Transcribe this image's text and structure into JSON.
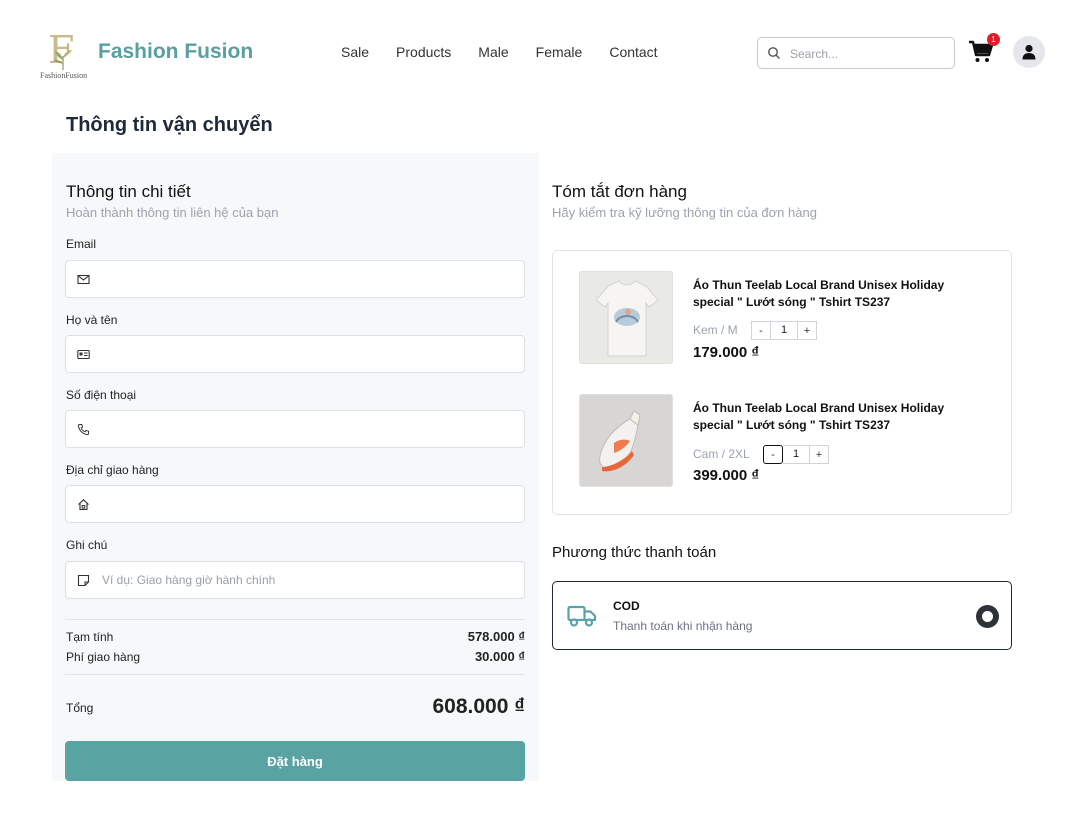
{
  "header": {
    "logo_letter": "F",
    "logo_small": "FashionFusion",
    "brand": "Fashion Fusion",
    "nav": [
      "Sale",
      "Products",
      "Male",
      "Female",
      "Contact"
    ],
    "search_placeholder": "Search...",
    "cart_count": "1"
  },
  "page_title": "Thông tin vận chuyển",
  "details": {
    "title": "Thông tin chi tiết",
    "subtitle": "Hoàn thành thông tin liên hệ của bạn",
    "fields": [
      {
        "label": "Email",
        "icon": "envelope-icon",
        "value": "",
        "placeholder": ""
      },
      {
        "label": "Họ và tên",
        "icon": "id-card-icon",
        "value": "",
        "placeholder": ""
      },
      {
        "label": "Số điện thoại",
        "icon": "phone-icon",
        "value": "",
        "placeholder": ""
      },
      {
        "label": "Địa chỉ giao hàng",
        "icon": "home-icon",
        "value": "",
        "placeholder": ""
      },
      {
        "label": "Ghi chú",
        "icon": "note-icon",
        "value": "",
        "placeholder": "Ví dụ: Giao hàng giờ hành chính"
      }
    ],
    "subtotal_label": "Tạm tính",
    "subtotal_value": "578.000 ₫",
    "shipping_label": "Phí giao hàng",
    "shipping_value": "30.000 ₫",
    "total_label": "Tổng",
    "total_value": "608.000 ₫",
    "order_button": "Đặt hàng"
  },
  "summary": {
    "title": "Tóm tắt đơn hàng",
    "subtitle": "Hãy kiểm tra kỹ lưỡng thông tin của đơn hàng",
    "items": [
      {
        "name": "Áo Thun Teelab Local Brand Unisex Holiday special \" Lướt sóng \" Tshirt TS237",
        "variant": "Kem / M",
        "quantity": "1",
        "price": "179.000 ₫",
        "minus": "-",
        "plus": "+"
      },
      {
        "name": "Áo Thun Teelab Local Brand Unisex Holiday special \" Lướt sóng \" Tshirt TS237",
        "variant": "Cam / 2XL",
        "quantity": "1",
        "price": "399.000 ₫",
        "minus": "-",
        "plus": "+"
      }
    ]
  },
  "payment": {
    "title": "Phương thức thanh toán",
    "method_name": "COD",
    "method_desc": "Thanh toán khi nhận hàng",
    "selected": true
  },
  "colors": {
    "brand": "#5a9fa0",
    "button": "#5aa3a3",
    "badge": "#e11d2a"
  }
}
